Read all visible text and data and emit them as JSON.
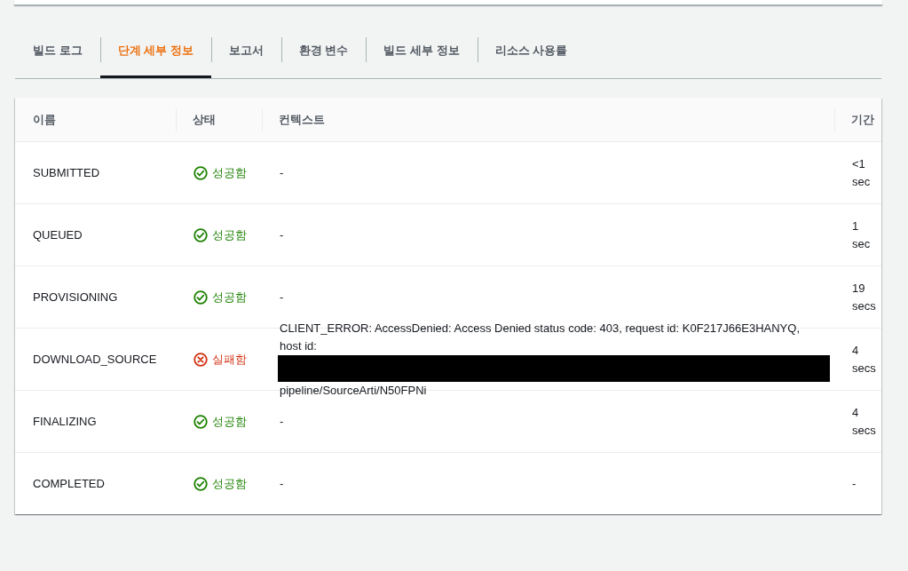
{
  "tabs": [
    {
      "label": "빌드 로그",
      "selected": false
    },
    {
      "label": "단계 세부 정보",
      "selected": true
    },
    {
      "label": "보고서",
      "selected": false
    },
    {
      "label": "환경 변수",
      "selected": false
    },
    {
      "label": "빌드 세부 정보",
      "selected": false
    },
    {
      "label": "리소스 사용률",
      "selected": false
    }
  ],
  "table": {
    "columns": [
      "이름",
      "상태",
      "컨텍스트",
      "기간"
    ],
    "rows": [
      {
        "name": "SUBMITTED",
        "status": {
          "kind": "success",
          "label": "성공함"
        },
        "context": [
          {
            "kind": "text",
            "text": "-"
          }
        ],
        "duration": "<1 sec"
      },
      {
        "name": "QUEUED",
        "status": {
          "kind": "success",
          "label": "성공함"
        },
        "context": [
          {
            "kind": "text",
            "text": "-"
          }
        ],
        "duration": "1 sec"
      },
      {
        "name": "PROVISIONING",
        "status": {
          "kind": "success",
          "label": "성공함"
        },
        "context": [
          {
            "kind": "text",
            "text": "-"
          }
        ],
        "duration": "19 secs"
      },
      {
        "name": "DOWNLOAD_SOURCE",
        "status": {
          "kind": "failure",
          "label": "실패함"
        },
        "context": [
          {
            "kind": "text",
            "text": "CLIENT_ERROR: AccessDenied: Access Denied status code: 403, request id: K0F217J66E3HANYQ, host id:"
          },
          {
            "kind": "redacted"
          },
          {
            "kind": "text",
            "text": "pipeline/SourceArti/N50FPNi"
          }
        ],
        "duration": "4 secs"
      },
      {
        "name": "FINALIZING",
        "status": {
          "kind": "success",
          "label": "성공함"
        },
        "context": [
          {
            "kind": "text",
            "text": "-"
          }
        ],
        "duration": "4 secs"
      },
      {
        "name": "COMPLETED",
        "status": {
          "kind": "success",
          "label": "성공함"
        },
        "context": [
          {
            "kind": "text",
            "text": "-"
          }
        ],
        "duration": "-"
      }
    ]
  }
}
